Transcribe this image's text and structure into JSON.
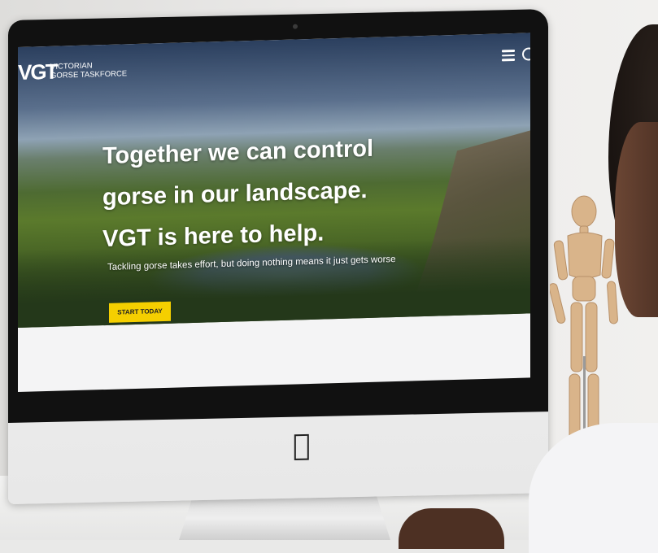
{
  "site": {
    "logo_mark": "VGT",
    "logo_line1": "VICTORIAN",
    "logo_line2": "GORSE TASKFORCE"
  },
  "hero": {
    "headline_line1": "Together we can control",
    "headline_line2": "gorse in our landscape.",
    "headline_line3": "VGT is here to help.",
    "subline": "Tackling gorse takes effort, but doing nothing means it just gets worse",
    "cta_label": "START TODAY"
  },
  "colors": {
    "accent": "#f5cf00",
    "text_on_hero": "#ffffff"
  },
  "icons": [
    "menu-icon",
    "search-icon",
    "apple-logo-icon"
  ]
}
